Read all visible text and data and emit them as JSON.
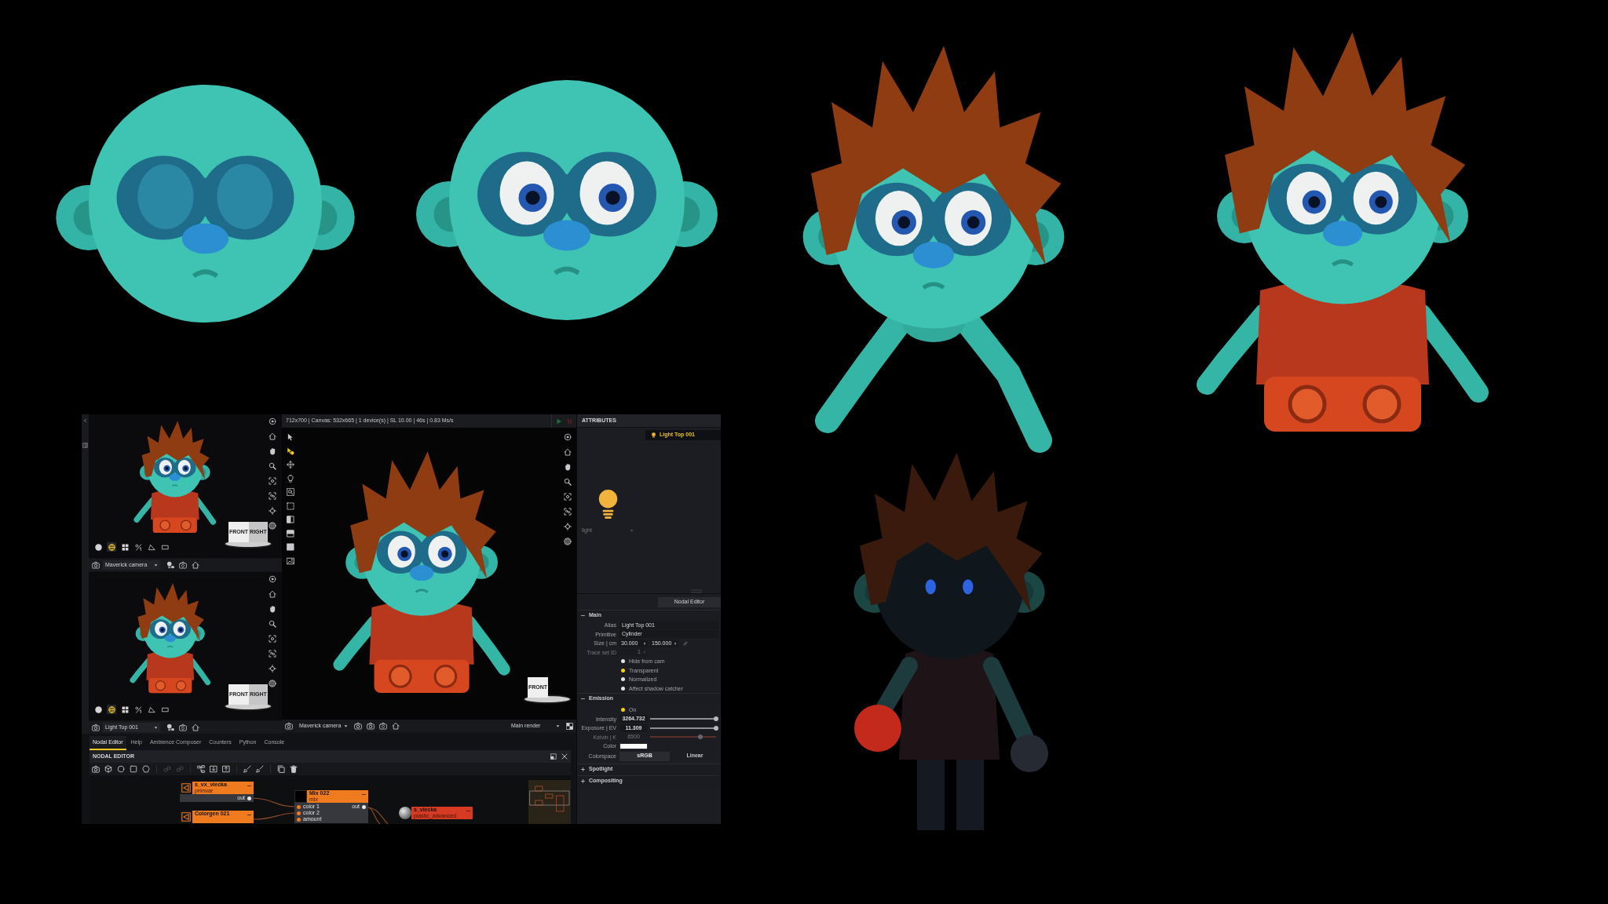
{
  "renders": [
    {
      "kind": "bald_head"
    },
    {
      "kind": "bald_head_eyes"
    },
    {
      "kind": "hair_arms"
    },
    {
      "kind": "hair_shirt"
    },
    {
      "kind": "silhouette"
    }
  ],
  "app": {
    "side_viewports": [
      {
        "gizmo_labels": [
          "FRONT",
          "RIGHT"
        ],
        "modes": [
          {
            "selected": false
          },
          {
            "selected": true
          },
          {
            "selected": false
          },
          {
            "selected": false
          },
          {
            "selected": false
          },
          {
            "selected": false
          }
        ],
        "camera": "Maverick camera"
      },
      {
        "gizmo_labels": [
          "FRONT",
          "RIGHT"
        ],
        "modes": [
          {
            "selected": false
          },
          {
            "selected": true
          },
          {
            "selected": false
          },
          {
            "selected": false
          },
          {
            "selected": false
          },
          {
            "selected": false
          }
        ],
        "camera": "Light Top 001"
      }
    ],
    "main_viewport": {
      "status": "712x700 | Canvas: 532x665 | 1 device(s) | SL 10.00 | 46s | 0.83 Ms/s",
      "tools": [
        {
          "selected": false
        },
        {
          "selected": true
        },
        {
          "selected": false
        },
        {
          "selected": false
        },
        {
          "selected": false
        },
        {
          "selected": false
        },
        {
          "selected": false
        },
        {
          "selected": false
        },
        {
          "selected": false
        },
        {
          "selected": false
        }
      ],
      "gizmo_labels": [
        "FRONT"
      ],
      "camera": "Maverick camera",
      "output": "Main render"
    },
    "attributes": {
      "title": "ATTRIBUTES",
      "selection": "Light Top 001",
      "type_dropdown": "light",
      "nodal_editor_button": "Nodal Editor",
      "sections": [
        {
          "title": "Main",
          "expanded": true,
          "rows": [
            {
              "kind": "text",
              "label": "Alias",
              "value": "Light Top 001",
              "disabled": false
            },
            {
              "kind": "text",
              "label": "Primitive",
              "value": "Cylinder",
              "disabled": false
            },
            {
              "kind": "pair",
              "label": "Size | cm",
              "values": [
                "30.000",
                "150.000"
              ],
              "disabled": false
            },
            {
              "kind": "spinner",
              "label": "Trace set ID",
              "value": "1",
              "disabled": true
            },
            {
              "kind": "radio",
              "label": "Hide from cam",
              "checked": false,
              "disabled": false
            },
            {
              "kind": "radio",
              "label": "Transparent",
              "checked": true,
              "disabled": false
            },
            {
              "kind": "radio",
              "label": "Normalized",
              "checked": false,
              "disabled": false
            },
            {
              "kind": "radio",
              "label": "Affect shadow catcher",
              "checked": false,
              "disabled": false
            }
          ]
        },
        {
          "title": "Emission",
          "expanded": true,
          "rows": [
            {
              "kind": "radio",
              "label": "On",
              "checked": true,
              "disabled": false
            },
            {
              "kind": "slider",
              "label": "Intensity",
              "value": "3264.732",
              "level": 1,
              "disabled": false
            },
            {
              "kind": "slider",
              "label": "Exposure | EV",
              "value": "11.309",
              "level": 1,
              "disabled": false
            },
            {
              "kind": "slider",
              "label": "Kelvin | K",
              "value": "6500",
              "level": 0.76,
              "disabled": true
            },
            {
              "kind": "color",
              "label": "Color",
              "color": "#ffffff",
              "disabled": false
            },
            {
              "kind": "choice",
              "label": "Colorspace",
              "options": [
                {
                  "label": "sRGB",
                  "selected": true
                },
                {
                  "label": "Linear",
                  "selected": false
                }
              ],
              "disabled": false
            }
          ]
        },
        {
          "title": "Spotlight",
          "expanded": false
        },
        {
          "title": "Compositing",
          "expanded": false
        }
      ]
    },
    "bottom_tabs": [
      {
        "label": "Nodal Editor",
        "selected": true
      },
      {
        "label": "Help",
        "selected": false
      },
      {
        "label": "Ambience Composer",
        "selected": false
      },
      {
        "label": "Counters",
        "selected": false
      },
      {
        "label": "Python",
        "selected": false
      },
      {
        "label": "Console",
        "selected": false
      }
    ],
    "nodal_editor": {
      "title": "NODAL EDITOR",
      "nodes": [
        {
          "kind": "icon",
          "title": "s_vx_viecka",
          "subtitle": "primvar",
          "color": "#f07a1e",
          "outputs": [
            "out"
          ]
        },
        {
          "kind": "icon",
          "title": "Colorgen 021",
          "color": "#f07a1e"
        },
        {
          "kind": "swatch",
          "title": "Mix 022",
          "subtitle": "mix",
          "color": "#f07a1e",
          "inputs": [
            "color 1",
            "color 2",
            "amount"
          ],
          "outputs": [
            "out"
          ]
        },
        {
          "kind": "sphere",
          "title": "s_viecka",
          "subtitle": "plastic_advanced",
          "color": "#d63a22"
        }
      ]
    }
  }
}
